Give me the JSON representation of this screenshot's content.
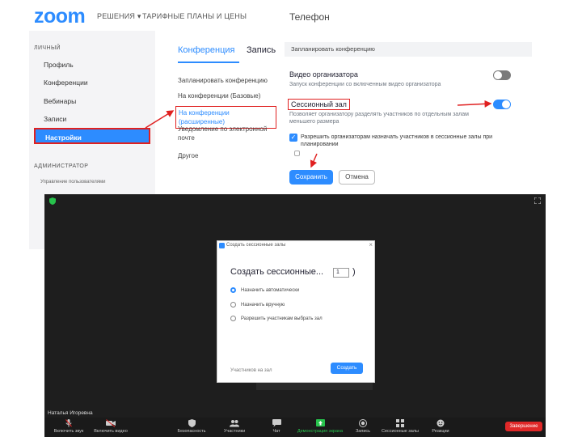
{
  "settings": {
    "logo": "zoom",
    "nav": {
      "solutions": "РЕШЕНИЯ ▾",
      "plans": "ТАРИФНЫЕ ПЛАНЫ И ЦЕНЫ",
      "phone": "Телефон"
    },
    "sidebar": {
      "personal_section": "ЛИЧНЫЙ",
      "items": [
        "Профиль",
        "Конференции",
        "Вебинары",
        "Записи",
        "Настройки"
      ],
      "admin_section": "АДМИНИСТРАТОР",
      "admin_item": "Управление пользователями"
    },
    "tabs": [
      "Конференция",
      "Запись"
    ],
    "submenu": [
      "Запланировать конференцию",
      "На конференции (Базовые)",
      "На конференции (расширенные)",
      "Уведомление по электронной почте",
      "Другое"
    ],
    "content": {
      "header": "Запланировать конференцию",
      "video_host_title": "Видео организатора",
      "video_host_desc": "Запуск конференции со включенным видео организатора",
      "video_host_on": false,
      "breakout_title": "Сессионный зал",
      "breakout_desc": "Позволяет организатору разделять участников по отдельным залам меньшего размера",
      "breakout_on": true,
      "allow_assign_label": "Разрешить организаторам назначать участников в сессионные залы при планировании",
      "allow_assign_checked": true,
      "save_label": "Сохранить",
      "cancel_label": "Отмена"
    }
  },
  "meeting": {
    "dialog": {
      "title_small": "Создать сессионные залы",
      "heading": "Создать сессионные...",
      "room_count": "1",
      "paren_close": ")",
      "options": [
        "Назначить автоматически",
        "Назначить вручную",
        "Разрешить участникам выбрать зал"
      ],
      "selected_option": 0,
      "participants_note": "Участников на зал",
      "create_label": "Создать"
    },
    "participant_name": "Наталья Игоревна",
    "toolbar": [
      {
        "label": "Включить звук",
        "icon": "mic-icon"
      },
      {
        "label": "Включить видео",
        "icon": "video-icon"
      },
      {
        "label": "Безопасность",
        "icon": "shield-icon"
      },
      {
        "label": "Участники",
        "icon": "participants-icon"
      },
      {
        "label": "Чат",
        "icon": "chat-icon"
      },
      {
        "label": "Демонстрация экрана",
        "icon": "share-screen-icon"
      },
      {
        "label": "Запись",
        "icon": "record-icon"
      },
      {
        "label": "Сессионные залы",
        "icon": "breakout-icon"
      },
      {
        "label": "Реакции",
        "icon": "reactions-icon"
      }
    ],
    "end_label": "Завершение"
  },
  "colors": {
    "accent": "#2D8CFF",
    "annotation": "#e02020",
    "meeting_bg": "#1e1e1e",
    "end_button": "#e02828",
    "share_green": "#27c24c"
  }
}
